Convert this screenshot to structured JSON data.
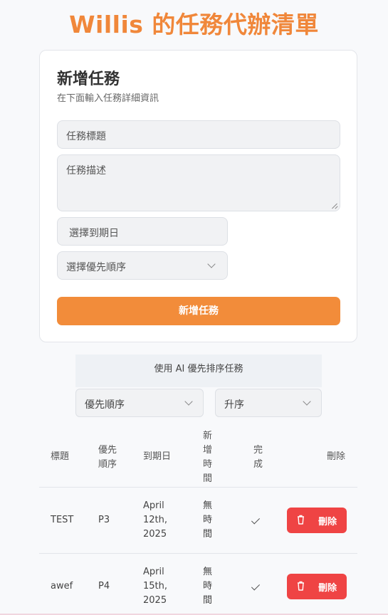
{
  "app": {
    "title": "Willis 的任務代辦清單"
  },
  "form": {
    "heading": "新增任務",
    "subheading": "在下面輸入任務詳細資訊",
    "title_placeholder": "任務標題",
    "description_placeholder": "任務描述",
    "due_date_placeholder": "選擇到期日",
    "priority_placeholder": "選擇優先順序",
    "submit_label": "新增任務"
  },
  "sorting": {
    "ai_button_label": "使用 AI 優先排序任務",
    "field_value": "優先順序",
    "order_value": "升序"
  },
  "table": {
    "headers": {
      "title": "標題",
      "priority": "優先順序",
      "due_date": "到期日",
      "created": "新增時間",
      "done": "完成",
      "delete": "刪除"
    },
    "rows": [
      {
        "title": "TEST",
        "priority": "P3",
        "due_date": "April 12th, 2025",
        "created": "無時間",
        "done": true,
        "delete_label": "刪除"
      },
      {
        "title": "awef",
        "priority": "P4",
        "due_date": "April 15th, 2025",
        "created": "無時間",
        "done": true,
        "delete_label": "刪除"
      }
    ]
  },
  "colors": {
    "accent": "#f28c3a",
    "title": "#f0873a",
    "danger": "#ef4444"
  }
}
